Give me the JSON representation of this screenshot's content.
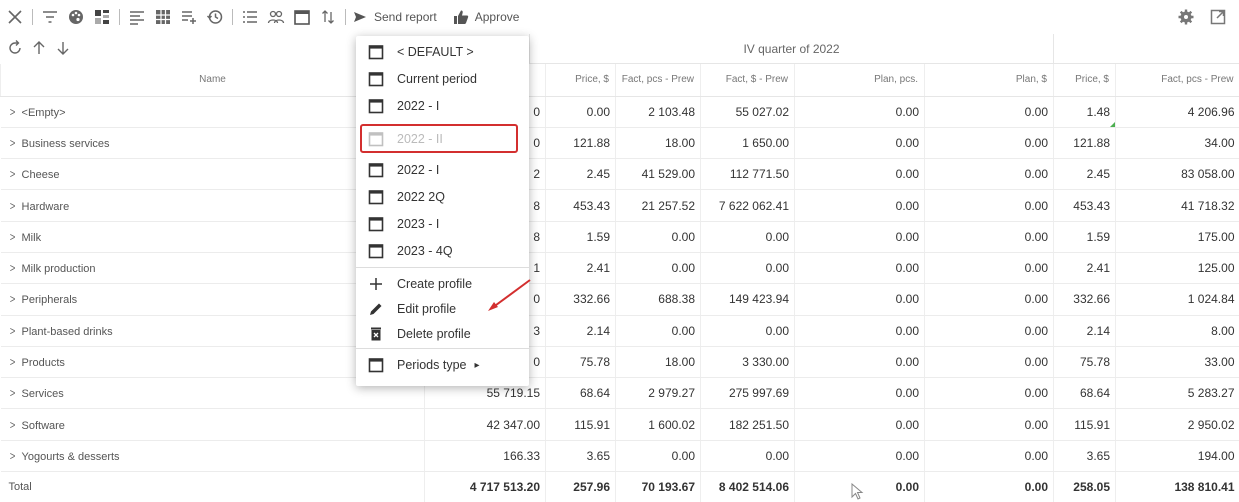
{
  "toolbar": {
    "send_report_label": "Send report",
    "approve_label": "Approve"
  },
  "group_header": {
    "label": "IV quarter of 2022"
  },
  "columns": [
    "Name",
    "",
    "Price, $",
    "Fact, pcs - Prew",
    "Fact, $ - Prew",
    "Plan, pcs.",
    "Plan, $",
    "Price, $",
    "Fact, pcs - Prew"
  ],
  "rows": [
    {
      "name": "<Empty>",
      "c1": "0",
      "c2": "0.00",
      "c3": "2 103.48",
      "c4": "55 027.02",
      "c5": "0.00",
      "c6": "0.00",
      "c7": "1.48",
      "c8": "4 206.96"
    },
    {
      "name": "Business services",
      "c1": "0",
      "c2": "121.88",
      "c3": "18.00",
      "c4": "1 650.00",
      "c5": "0.00",
      "c6": "0.00",
      "c7": "121.88",
      "c8": "34.00"
    },
    {
      "name": "Cheese",
      "c1": "2",
      "c2": "2.45",
      "c3": "41 529.00",
      "c4": "112 771.50",
      "c5": "0.00",
      "c6": "0.00",
      "c7": "2.45",
      "c8": "83 058.00"
    },
    {
      "name": "Hardware",
      "c1": "8",
      "c2": "453.43",
      "c3": "21 257.52",
      "c4": "7 622 062.41",
      "c5": "0.00",
      "c6": "0.00",
      "c7": "453.43",
      "c8": "41 718.32"
    },
    {
      "name": "Milk",
      "c1": "8",
      "c2": "1.59",
      "c3": "0.00",
      "c4": "0.00",
      "c5": "0.00",
      "c6": "0.00",
      "c7": "1.59",
      "c8": "175.00"
    },
    {
      "name": "Milk production",
      "c1": "1",
      "c2": "2.41",
      "c3": "0.00",
      "c4": "0.00",
      "c5": "0.00",
      "c6": "0.00",
      "c7": "2.41",
      "c8": "125.00"
    },
    {
      "name": "Peripherals",
      "c1": "0",
      "c2": "332.66",
      "c3": "688.38",
      "c4": "149 423.94",
      "c5": "0.00",
      "c6": "0.00",
      "c7": "332.66",
      "c8": "1 024.84"
    },
    {
      "name": "Plant-based drinks",
      "c1": "3",
      "c2": "2.14",
      "c3": "0.00",
      "c4": "0.00",
      "c5": "0.00",
      "c6": "0.00",
      "c7": "2.14",
      "c8": "8.00"
    },
    {
      "name": "Products",
      "c1": "0",
      "c2": "75.78",
      "c3": "18.00",
      "c4": "3 330.00",
      "c5": "0.00",
      "c6": "0.00",
      "c7": "75.78",
      "c8": "33.00"
    },
    {
      "name": "Services",
      "c1": "55 719.15",
      "c2": "68.64",
      "c3": "2 979.27",
      "c4": "275 997.69",
      "c5": "0.00",
      "c6": "0.00",
      "c7": "68.64",
      "c8": "5 283.27"
    },
    {
      "name": "Software",
      "c1": "42 347.00",
      "c2": "115.91",
      "c3": "1 600.02",
      "c4": "182 251.50",
      "c5": "0.00",
      "c6": "0.00",
      "c7": "115.91",
      "c8": "2 950.02"
    },
    {
      "name": "Yogourts & desserts",
      "c1": "166.33",
      "c2": "3.65",
      "c3": "0.00",
      "c4": "0.00",
      "c5": "0.00",
      "c6": "0.00",
      "c7": "3.65",
      "c8": "194.00"
    }
  ],
  "total": {
    "name": "Total",
    "c1": "4 717 513.20",
    "c2": "257.96",
    "c3": "70 193.67",
    "c4": "8 402 514.06",
    "c5": "0.00",
    "c6": "0.00",
    "c7": "258.05",
    "c8": "138 810.41"
  },
  "menu": {
    "items": [
      {
        "label": "< DEFAULT >",
        "icon": "calendar-icon"
      },
      {
        "label": "Current period",
        "icon": "calendar-icon"
      },
      {
        "label": "2022 - I",
        "icon": "calendar-icon"
      },
      {
        "label": "2022 - II",
        "icon": "calendar-icon"
      },
      {
        "label": "2022 - I",
        "icon": "calendar-icon"
      },
      {
        "label": "2022 2Q",
        "icon": "calendar-icon"
      },
      {
        "label": "2023 - I",
        "icon": "calendar-icon"
      },
      {
        "label": "2023 - 4Q",
        "icon": "calendar-icon"
      },
      {
        "label": "Create profile",
        "icon": "plus-icon"
      },
      {
        "label": "Edit profile",
        "icon": "pencil-icon"
      },
      {
        "label": "Delete profile",
        "icon": "trash-icon"
      },
      {
        "label": "Periods type",
        "icon": "calendar-icon"
      }
    ],
    "submenu_arrow": "▸"
  },
  "colors": {
    "highlight": "#d32f2f",
    "corner_mark": "#4caf50"
  }
}
